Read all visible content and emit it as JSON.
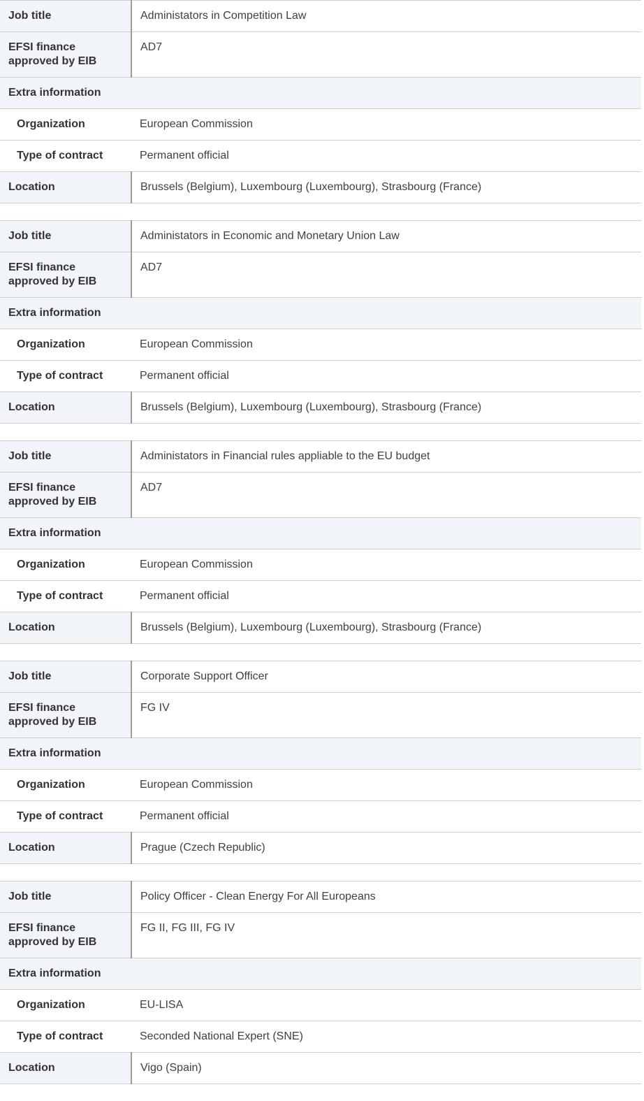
{
  "labels": {
    "job_title": "Job title",
    "efsi": "EFSI finance approved by EIB",
    "extra": "Extra information",
    "organization": "Organization",
    "contract": "Type of contract",
    "location": "Location"
  },
  "jobs": [
    {
      "title": "Administators in Competition Law",
      "grade": "AD7",
      "organization": "European Commission",
      "contract": "Permanent official",
      "location": "Brussels (Belgium), Luxembourg (Luxembourg), Strasbourg (France)"
    },
    {
      "title": "Administators in Economic and Monetary Union Law",
      "grade": "AD7",
      "organization": "European Commission",
      "contract": "Permanent official",
      "location": "Brussels (Belgium), Luxembourg (Luxembourg), Strasbourg (France)"
    },
    {
      "title": "Administators in Financial rules appliable to the EU budget",
      "grade": "AD7",
      "organization": "European Commission",
      "contract": "Permanent official",
      "location": "Brussels (Belgium), Luxembourg (Luxembourg), Strasbourg (France)"
    },
    {
      "title": "Corporate Support Officer",
      "grade": "FG IV",
      "organization": "European Commission",
      "contract": "Permanent official",
      "location": "Prague (Czech Republic)"
    },
    {
      "title": "Policy Officer - Clean Energy For All Europeans",
      "grade": "FG II, FG III, FG IV",
      "organization": "EU-LISA",
      "contract": "Seconded National Expert (SNE)",
      "location": "Vigo (Spain)"
    }
  ]
}
